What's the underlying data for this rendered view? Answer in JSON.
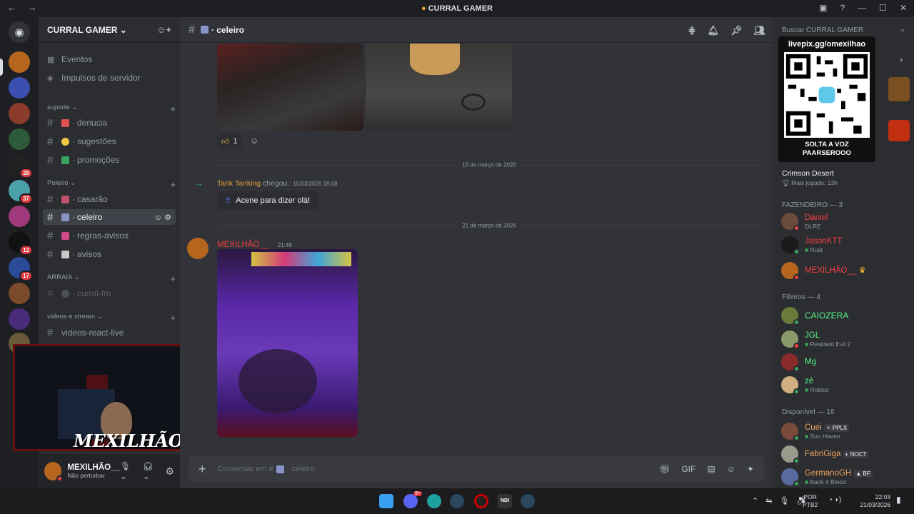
{
  "window": {
    "title": "CURRAL GAMER"
  },
  "guild": {
    "name": "CURRAL GAMER"
  },
  "server_badges": [
    "28",
    "37",
    "12",
    "17"
  ],
  "nav": {
    "events": "Eventos",
    "boosts": "Impulsos de servidor"
  },
  "categories": [
    {
      "name": "suporte",
      "channels": [
        "denucia",
        "sugestões",
        "promoções"
      ]
    },
    {
      "name": "Puleiro",
      "channels": [
        "casarão",
        "celeiro",
        "regras-avisos",
        "avisos"
      ]
    },
    {
      "name": "ARRAIA",
      "channels": [
        "curral-fm"
      ]
    },
    {
      "name": "videos e stream",
      "channels": [
        "videos-react-live"
      ]
    }
  ],
  "active_channel": "celeiro",
  "user": {
    "name": "MEXILHÃO__",
    "status": "Não perturbar"
  },
  "messages": {
    "reaction_count": "1",
    "date1": "15 de março de 2026",
    "join_user": "Tank Tanking",
    "join_text": "chegou.",
    "join_time": "15/03/2026 18:08",
    "wave_button": "Acene para dizer olá!",
    "date2": "21 de março de 2026",
    "author": "MEXILHÃO__",
    "author_time": "21:48"
  },
  "composer": {
    "placeholder": "Conversar em #",
    "channel": "celeiro"
  },
  "members_panel": {
    "search_placeholder": "Buscar CURRAL GAMER",
    "qr_url": "livepix.gg/omexilhao",
    "qr_caption1": "SOLTA A VOZ",
    "qr_caption2": "PAARSEROOO",
    "game_title": "Crimson Desert",
    "game_sub": "Mais jogado: 13h",
    "sections": [
      {
        "title": "FAZENDEIRO — 3",
        "members": [
          {
            "name": "Daniel",
            "sub": "DLRE",
            "color": "#f23f43"
          },
          {
            "name": "JasonKTT",
            "sub": "Rust",
            "color": "#f23f43"
          },
          {
            "name": "MEXILHÃO__",
            "sub": "",
            "color": "#f23f43"
          }
        ]
      },
      {
        "title": "Fifeiros — 4",
        "members": [
          {
            "name": "CAIOZERA",
            "sub": "",
            "color": "#57f287"
          },
          {
            "name": "JGL",
            "sub": "Resident Evil 2",
            "color": "#57f287"
          },
          {
            "name": "Mg",
            "sub": "",
            "color": "#57f287"
          },
          {
            "name": "zé",
            "sub": "Roblox",
            "color": "#57f287"
          }
        ]
      },
      {
        "title": "Disponível — 16",
        "members": [
          {
            "name": "Cuei",
            "sub": "Sun Haven",
            "tag": "PPLX",
            "color": "#f0a35e"
          },
          {
            "name": "FabriGiga",
            "sub": "",
            "tag": "NOCT",
            "color": "#f0a35e"
          },
          {
            "name": "GermanoGH",
            "sub": "Back 4 Blood",
            "tag": "BF",
            "color": "#f0a35e"
          }
        ]
      }
    ]
  },
  "webcam_overlay": "MEXILHÃO",
  "taskbar": {
    "lang1": "POR",
    "lang2": "PTB2",
    "time": "22:03",
    "date": "21/03/2026",
    "discord_badge": "9+"
  }
}
